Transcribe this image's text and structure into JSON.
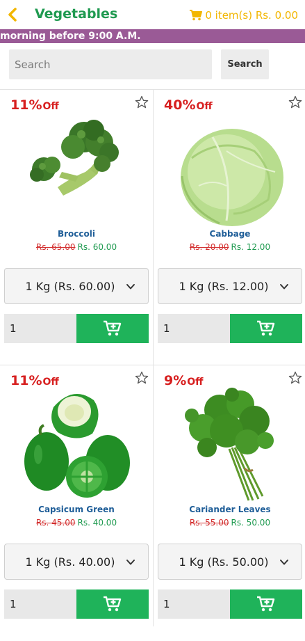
{
  "header": {
    "title": "Vegetables",
    "cart_text": "0 item(s) Rs. 0.00",
    "back_icon": "chevron-left-icon",
    "cart_icon": "cart-icon"
  },
  "banner": {
    "text": "morning before 9:00 A.M."
  },
  "search": {
    "placeholder": "Search",
    "button_label": "Search"
  },
  "colors": {
    "brand_green": "#1f9a50",
    "accent_yellow": "#f2b600",
    "banner_purple": "#9a5a96",
    "discount_red": "#d71f1f",
    "add_button_green": "#1fb35a"
  },
  "products": [
    {
      "name": "Broccoli",
      "discount": "11%",
      "off_label": "Off",
      "mrp": "Rs. 65.00",
      "price": "Rs. 60.00",
      "variant": "1 Kg (Rs. 60.00)",
      "qty": "1"
    },
    {
      "name": "Cabbage",
      "discount": "40%",
      "off_label": "Off",
      "mrp": "Rs. 20.00",
      "price": "Rs. 12.00",
      "variant": "1 Kg (Rs. 12.00)",
      "qty": "1"
    },
    {
      "name": "Capsicum Green",
      "discount": "11%",
      "off_label": "Off",
      "mrp": "Rs. 45.00",
      "price": "Rs. 40.00",
      "variant": "1 Kg (Rs. 40.00)",
      "qty": "1"
    },
    {
      "name": "Cariander Leaves",
      "discount": "9%",
      "off_label": "Off",
      "mrp": "Rs. 55.00",
      "price": "Rs. 50.00",
      "variant": "1 Kg (Rs. 50.00)",
      "qty": "1"
    }
  ]
}
